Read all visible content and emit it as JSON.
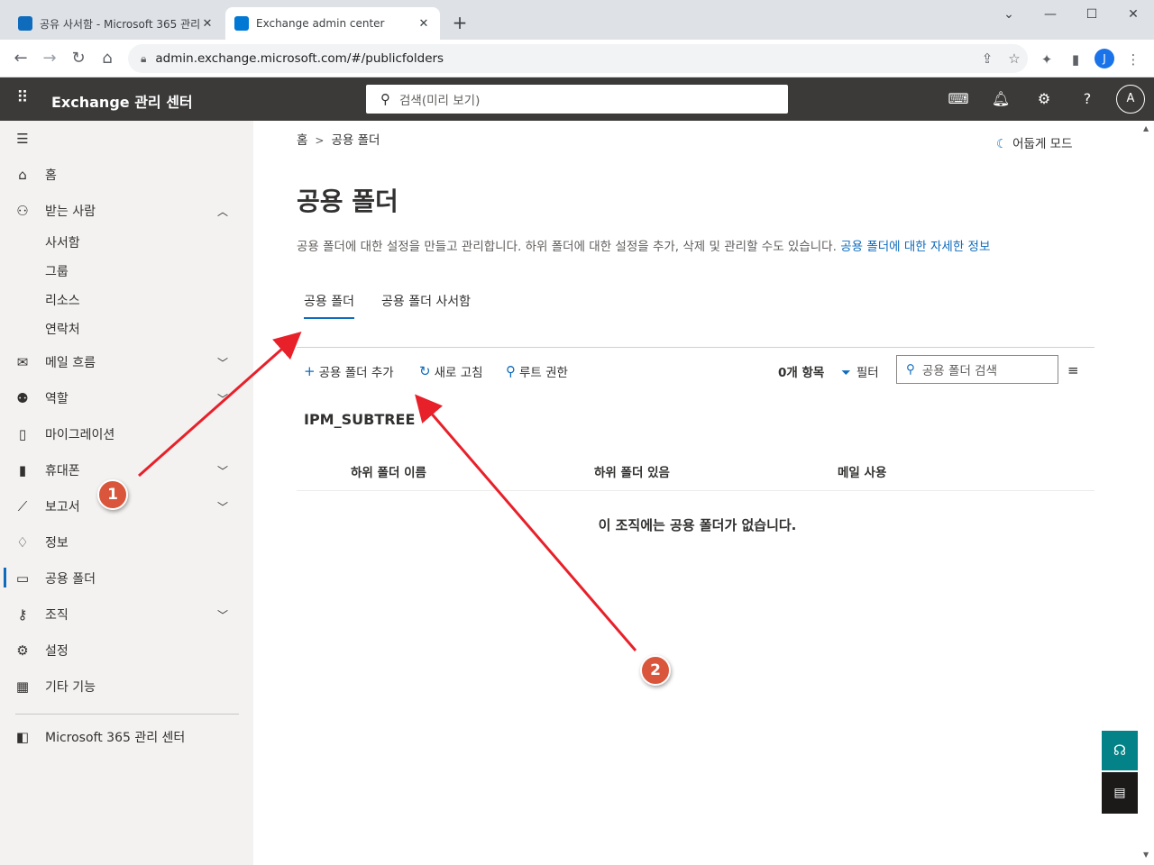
{
  "browser": {
    "tabs": [
      {
        "title": "공유 사서함 - Microsoft 365 관리",
        "favicon_color": "#0f6cbd"
      },
      {
        "title": "Exchange admin center",
        "favicon_color": "#0078d4"
      }
    ],
    "close_glyph": "✕",
    "newtab_glyph": "+",
    "url": "admin.exchange.microsoft.com/#/publicfolders",
    "profile_initial": "J"
  },
  "header": {
    "app_title": "Exchange 관리 센터",
    "search_placeholder": "검색(미리 보기)",
    "avatar_initial": "A"
  },
  "nav": {
    "items": [
      {
        "label": "홈",
        "icon": "home-icon"
      },
      {
        "label": "받는 사람",
        "icon": "person-icon",
        "expanded": true
      },
      {
        "label": "메일 흐름",
        "icon": "mail-icon"
      },
      {
        "label": "역할",
        "icon": "roles-icon"
      },
      {
        "label": "마이그레이션",
        "icon": "migration-icon"
      },
      {
        "label": "휴대폰",
        "icon": "mobile-icon"
      },
      {
        "label": "보고서",
        "icon": "reports-icon"
      },
      {
        "label": "정보",
        "icon": "insights-icon"
      },
      {
        "label": "공용 폴더",
        "icon": "public-folder-icon",
        "selected": true
      },
      {
        "label": "조직",
        "icon": "organization-icon"
      },
      {
        "label": "설정",
        "icon": "settings-icon"
      },
      {
        "label": "기타 기능",
        "icon": "other-features-icon"
      },
      {
        "label": "Microsoft 365 관리 센터",
        "icon": "office-icon"
      }
    ],
    "recipients_sub": [
      "사서함",
      "그룹",
      "리소스",
      "연락처"
    ]
  },
  "main": {
    "breadcrumb": {
      "home": "홈",
      "separator": ">",
      "current": "공용 폴더"
    },
    "dark_mode": "어둡게 모드",
    "title": "공용 폴더",
    "description": "공용 폴더에 대한 설정을 만들고 관리합니다. 하위 폴더에 대한 설정을 추가, 삭제 및 관리할 수도 있습니다.",
    "learn_more": "공용 폴더에 대한 자세한 정보",
    "tabs": [
      "공용 폴더",
      "공용 폴더 사서함"
    ],
    "commands": {
      "add": "공용 폴더 추가",
      "refresh": "새로 고침",
      "root_permissions": "루트 권한"
    },
    "item_count": "0개 항목",
    "filter": "필터",
    "search_placeholder": "공용 폴더 검색",
    "section_title": "IPM_SUBTREE",
    "columns": [
      "하위 폴더 이름",
      "하위 폴더 있음",
      "메일 사용"
    ],
    "empty_message": "이 조직에는 공용 폴더가 없습니다."
  },
  "annotations": [
    {
      "label": "1",
      "color": "#d9553b"
    },
    {
      "label": "2",
      "color": "#d9553b"
    }
  ],
  "colors": {
    "accent": "#0f6cbd",
    "header_bg": "#3b3a39",
    "nav_bg": "#f3f2f1",
    "arrow": "#e8202a"
  }
}
